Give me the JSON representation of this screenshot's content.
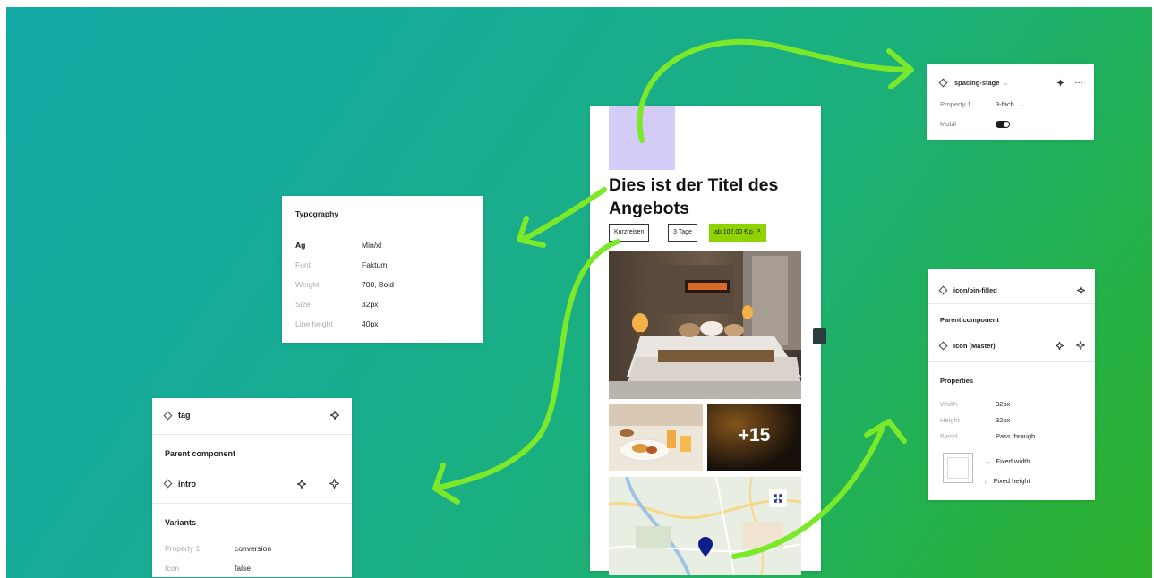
{
  "colors": {
    "arrow": "#7be82a",
    "price_chip": "#8fd400",
    "placeholder_block": "#d4cbf7",
    "map_pin": "#0e1f8a"
  },
  "panel_spacing": {
    "name": "spacing-stage",
    "property_label": "Property 1",
    "property_value": "3-fach",
    "mobile_label": "Mobil",
    "more": "···"
  },
  "panel_typography": {
    "title": "Typography",
    "rows": [
      {
        "key": "Ag",
        "value": "Min/xl"
      },
      {
        "key": "Font",
        "value": "Faktum"
      },
      {
        "key": "Weight",
        "value": "700, Bold"
      },
      {
        "key": "Size",
        "value": "32px"
      },
      {
        "key": "Line height",
        "value": "40px"
      }
    ]
  },
  "panel_tag": {
    "name": "tag",
    "parent_heading": "Parent component",
    "parent_name": "intro",
    "variants_heading": "Variants",
    "variant_rows": [
      {
        "key": "Property 1",
        "value": "conversion"
      },
      {
        "key": "Icon",
        "value": "false"
      }
    ]
  },
  "panel_icon": {
    "name": "icon/pin-filled",
    "parent_heading": "Parent component",
    "parent_name": "Icon (Master)",
    "properties_heading": "Properties",
    "properties": [
      {
        "key": "Width",
        "value": "32px"
      },
      {
        "key": "Height",
        "value": "32px"
      },
      {
        "key": "Blend",
        "value": "Pass through"
      }
    ],
    "fixed_width": "Fixed width",
    "fixed_height": "Fixed height"
  },
  "phone": {
    "title": "Dies ist der Titel des Angebots",
    "chips": [
      "Kurzreisen",
      "3 Tage",
      "ab 102,00 € p. P."
    ],
    "more_count": "+15"
  }
}
